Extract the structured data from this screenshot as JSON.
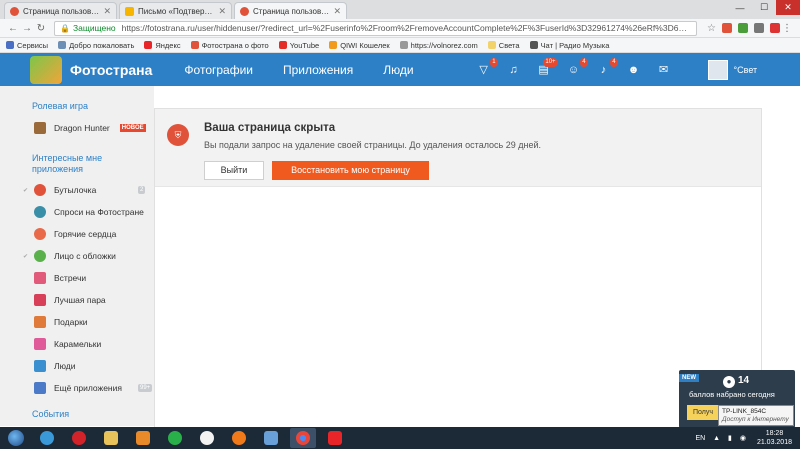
{
  "browser": {
    "tabs": [
      {
        "title": "Страница пользовател",
        "active": false
      },
      {
        "title": "Письмо «Подтвержден",
        "active": false
      },
      {
        "title": "Страница пользовател",
        "active": true
      }
    ],
    "secure_label": "Защищено",
    "url": "https://fotostrana.ru/user/hiddenuser/?redirect_url=%2Fuserinfo%2Froom%2FremoveAccountComplete%2F%3FuserId%3D32961274%26eRf%3D690&eRf=...",
    "bookmarks": [
      "Сервисы",
      "Добро пожаловать",
      "Яндекс",
      "Фотострана о фото",
      "YouTube",
      "QIWI Кошелек",
      "https://volnorez.com",
      "Света",
      "Чат | Радио Музыка"
    ]
  },
  "site": {
    "logo_text": "Фотострана",
    "menu": [
      "Фотографии",
      "Приложения",
      "Люди"
    ],
    "header_badges": {
      "gifts": "1",
      "friends": "10+",
      "guests": "4",
      "notifications": "4"
    },
    "username": "°Свет"
  },
  "sidebar": {
    "section_game": "Ролевая игра",
    "game_item": {
      "label": "Dragon Hunter",
      "badge": "НОВОЕ"
    },
    "section_apps": "Интересные мне приложения",
    "items": [
      {
        "label": "Бутылочка",
        "count": "2"
      },
      {
        "label": "Спроси на Фотостране"
      },
      {
        "label": "Горячие сердца"
      },
      {
        "label": "Лицо с обложки"
      },
      {
        "label": "Встречи"
      },
      {
        "label": "Лучшая пара"
      },
      {
        "label": "Подарки"
      },
      {
        "label": "Карамельки"
      },
      {
        "label": "Люди"
      },
      {
        "label": "Ещё приложения",
        "count": "99+"
      }
    ],
    "section_events": "События"
  },
  "notice": {
    "title": "Ваша страница скрыта",
    "text": "Вы подали запрос на удаление своей страницы. До удаления осталось 29 дней.",
    "exit_label": "Выйти",
    "restore_label": "Восстановить мою страницу"
  },
  "points_popup": {
    "new_label": "NEW",
    "points": "14",
    "text": "баллов набрано сегодня",
    "button": "Получ"
  },
  "wifi_tooltip": {
    "network": "TP-LINK_854C",
    "status": "Доступ к Интернету"
  },
  "taskbar": {
    "lang": "EN",
    "time": "18:28",
    "date": "21.03.2018"
  }
}
